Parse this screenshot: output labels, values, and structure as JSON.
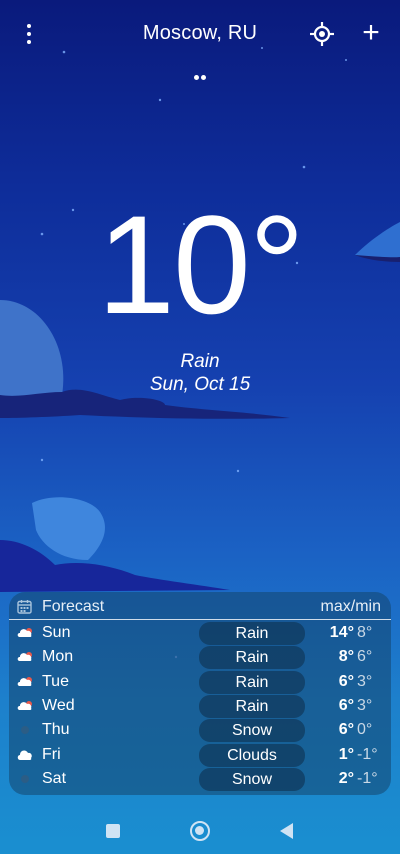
{
  "header": {
    "menu_icon": "more-vertical-icon",
    "city": "Moscow, RU",
    "location_icon": "crosshair-icon",
    "add_label": "+"
  },
  "current": {
    "temperature": "10°",
    "condition": "Rain",
    "date": "Sun, Oct 15"
  },
  "forecast": {
    "title": "Forecast",
    "maxmin_label": "max/min",
    "days": [
      {
        "day": "Sun",
        "condition": "Rain",
        "max": "14°",
        "min": "8°",
        "icon": "rain-cloud-icon"
      },
      {
        "day": "Mon",
        "condition": "Rain",
        "max": "8°",
        "min": "6°",
        "icon": "rain-cloud-icon"
      },
      {
        "day": "Tue",
        "condition": "Rain",
        "max": "6°",
        "min": "3°",
        "icon": "rain-cloud-icon"
      },
      {
        "day": "Wed",
        "condition": "Rain",
        "max": "6°",
        "min": "3°",
        "icon": "rain-cloud-icon"
      },
      {
        "day": "Thu",
        "condition": "Snow",
        "max": "6°",
        "min": "0°",
        "icon": "snow-icon"
      },
      {
        "day": "Fri",
        "condition": "Clouds",
        "max": "1°",
        "min": "-1°",
        "icon": "cloud-icon"
      },
      {
        "day": "Sat",
        "condition": "Snow",
        "max": "2°",
        "min": "-1°",
        "icon": "snow-icon"
      }
    ]
  },
  "colors": {
    "sky_top": "#0a1a7c",
    "sky_bottom": "#1a8fd0",
    "card_bg": "#14466e"
  }
}
